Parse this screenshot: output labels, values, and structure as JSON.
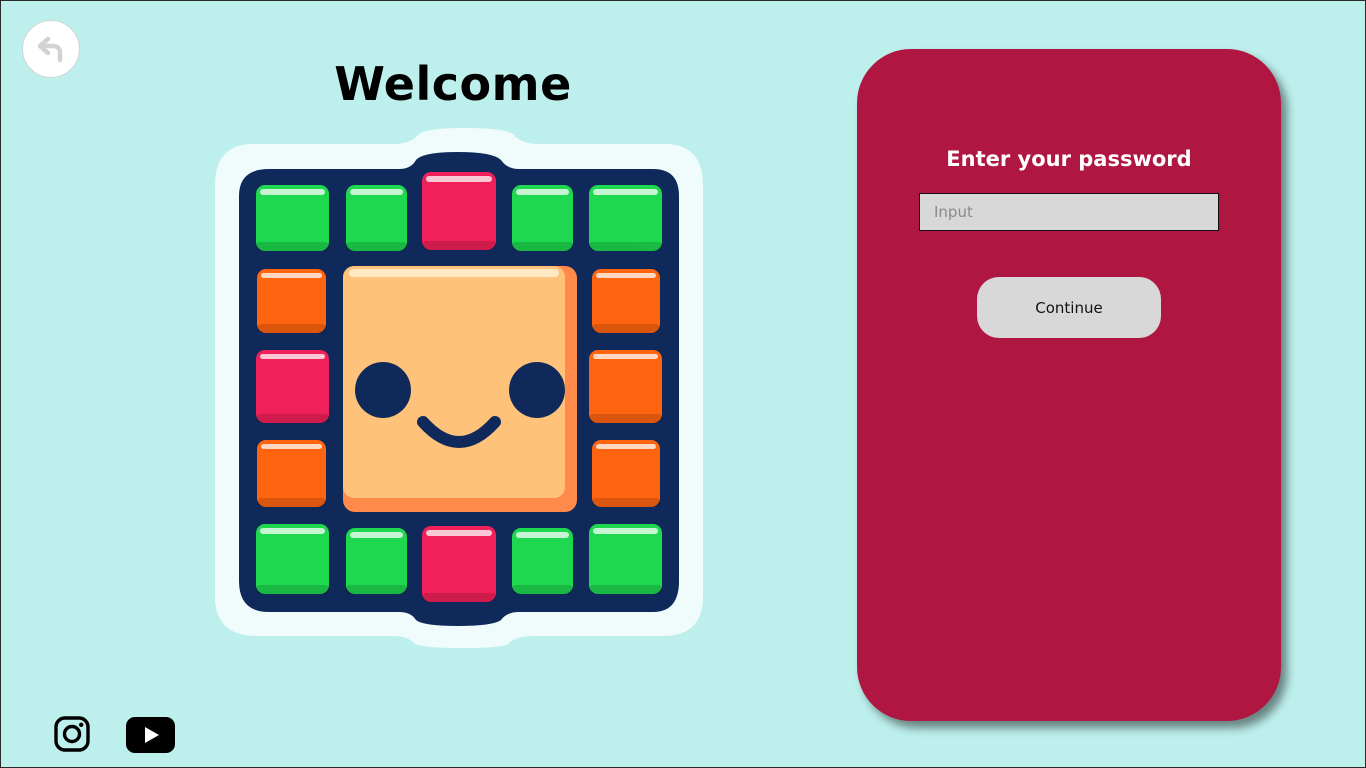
{
  "page": {
    "title": "Welcome",
    "background_color": "#bdefec"
  },
  "nav": {
    "back_icon": "undo-arrow-icon"
  },
  "logo": {
    "description_icon": "smiley-block-logo-icon",
    "colors": {
      "frame": "#0f2a5a",
      "green": "#1ed84f",
      "red": "#f0205a",
      "orange": "#ff6410",
      "face": "#ffc27a"
    }
  },
  "login_card": {
    "title": "Enter your password",
    "password_field": {
      "value": "",
      "placeholder": "Input"
    },
    "continue_label": "Continue",
    "background_color": "#b01642"
  },
  "social": {
    "items": [
      {
        "name": "instagram",
        "icon": "instagram-icon"
      },
      {
        "name": "youtube",
        "icon": "youtube-icon"
      }
    ]
  }
}
